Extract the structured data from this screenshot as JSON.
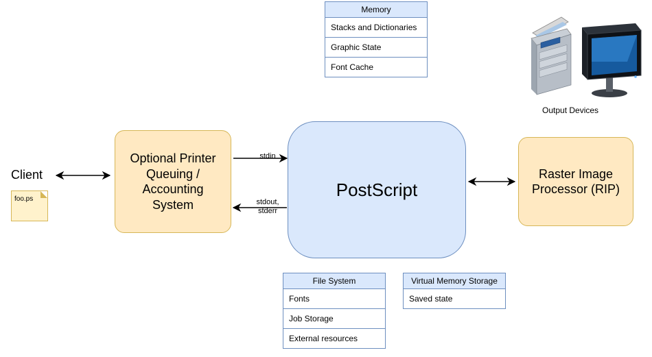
{
  "client": {
    "label": "Client",
    "file": "foo.ps"
  },
  "queuing": {
    "text": "Optional Printer Queuing / Accounting System"
  },
  "postscript": {
    "text": "PostScript"
  },
  "rip": {
    "text": "Raster Image Processor (RIP)"
  },
  "memory": {
    "title": "Memory",
    "rows": [
      "Stacks and Dictionaries",
      "Graphic State",
      "Font Cache"
    ]
  },
  "filesystem": {
    "title": "File System",
    "rows": [
      "Fonts",
      "Job Storage",
      "External resources"
    ]
  },
  "vm": {
    "title": "Virtual Memory Storage",
    "rows": [
      "Saved state"
    ]
  },
  "output": {
    "label": "Output Devices"
  },
  "arrows": {
    "stdin": "stdin",
    "stdout": "stdout, stderr"
  }
}
